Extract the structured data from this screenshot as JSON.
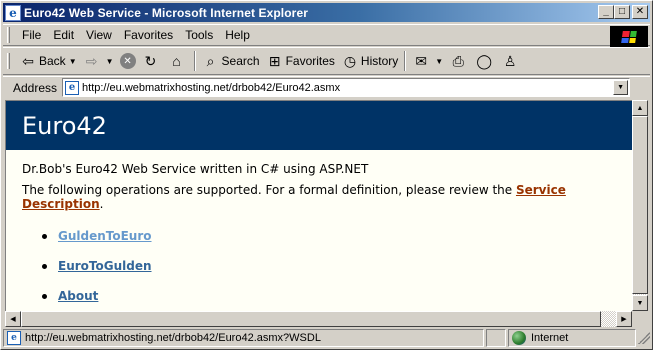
{
  "window": {
    "title": "Euro42 Web Service - Microsoft Internet Explorer",
    "icon": "ie-icon"
  },
  "titlebar_buttons": {
    "minimize": "_",
    "maximize": "□",
    "close": "✕"
  },
  "menu": {
    "items": [
      "File",
      "Edit",
      "View",
      "Favorites",
      "Tools",
      "Help"
    ]
  },
  "toolbar": {
    "back_label": "Back",
    "search_label": "Search",
    "favorites_label": "Favorites",
    "history_label": "History"
  },
  "address": {
    "label": "Address",
    "url": "http://eu.webmatrixhosting.net/drbob42/Euro42.asmx"
  },
  "page": {
    "banner_title": "Euro42",
    "intro": "Dr.Bob's Euro42 Web Service written in C# using ASP.NET",
    "ops_text": "The following operations are supported.  For a formal definition, please review the ",
    "service_link": "Service Description",
    "ops_text_end": ".",
    "operations": [
      {
        "label": "GuldenToEuro",
        "visited": true
      },
      {
        "label": "EuroToGulden",
        "visited": false
      },
      {
        "label": "About",
        "visited": false
      }
    ]
  },
  "status": {
    "text": "http://eu.webmatrixhosting.net/drbob42/Euro42.asmx?WSDL",
    "zone": "Internet"
  },
  "colors": {
    "banner_bg": "#003366",
    "link": "#336699",
    "visited_link": "#6699cc",
    "service_link": "#993300",
    "page_bg": "#fffff6"
  }
}
